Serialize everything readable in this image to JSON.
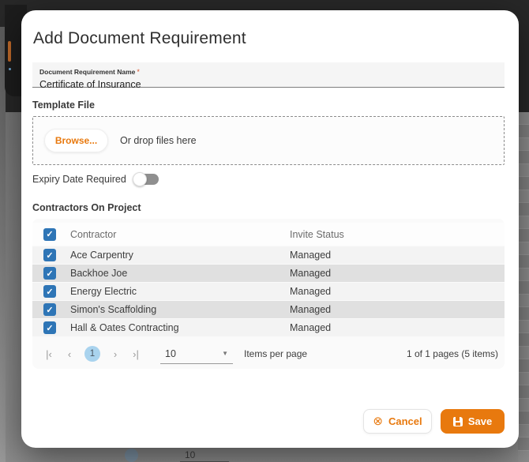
{
  "colors": {
    "accent_orange": "#e8790e",
    "checkbox_blue": "#2e75b6",
    "page_circle_blue": "#a9d3ee",
    "overlay_gray": "#828282",
    "dark_header": "#282828"
  },
  "background": {
    "pager_page_size_hint": "10"
  },
  "icons": {
    "check": "✓",
    "first_page": "|‹",
    "prev_page": "‹",
    "next_page": "›",
    "last_page": "›|",
    "caret_down": "▼",
    "cancel_circle_x": "⊗"
  },
  "modal": {
    "title": "Add Document Requirement",
    "name_field": {
      "label": "Document Requirement Name",
      "required_marker": "*",
      "value": "Certificate of Insurance"
    },
    "template_file": {
      "label": "Template File",
      "browse_label": "Browse...",
      "drop_hint": "Or drop files here"
    },
    "expiry_toggle": {
      "label": "Expiry Date Required",
      "state": "off"
    },
    "contractors": {
      "label": "Contractors On Project",
      "columns": {
        "contractor": "Contractor",
        "invite_status": "Invite Status"
      },
      "rows": [
        {
          "contractor": "Ace Carpentry",
          "invite_status": "Managed",
          "checked": true
        },
        {
          "contractor": "Backhoe Joe",
          "invite_status": "Managed",
          "checked": true
        },
        {
          "contractor": "Energy Electric",
          "invite_status": "Managed",
          "checked": true
        },
        {
          "contractor": "Simon's Scaffolding",
          "invite_status": "Managed",
          "checked": true
        },
        {
          "contractor": "Hall & Oates Contracting",
          "invite_status": "Managed",
          "checked": true
        }
      ],
      "pager": {
        "current_page": "1",
        "page_size": "10",
        "items_per_page_label": "Items per page",
        "summary": "1 of 1 pages (5 items)"
      }
    },
    "actions": {
      "cancel_label": "Cancel",
      "save_label": "Save"
    }
  }
}
